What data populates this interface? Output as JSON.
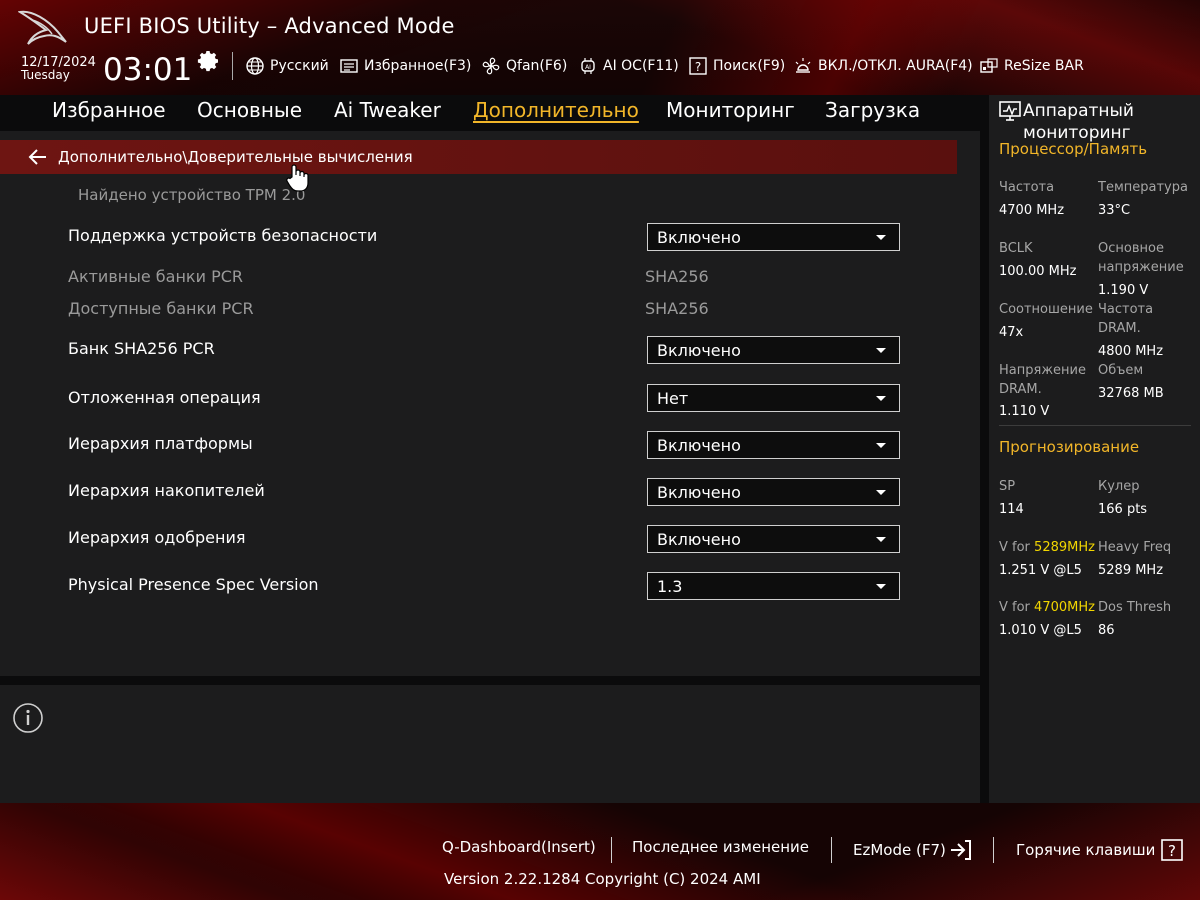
{
  "header": {
    "title": "UEFI BIOS Utility – Advanced Mode",
    "date": "12/17/2024",
    "weekday": "Tuesday",
    "time": "03:01",
    "tools": [
      {
        "label": "Русский",
        "icon": "globe-icon"
      },
      {
        "label": "Избранное(F3)",
        "icon": "favorites-icon"
      },
      {
        "label": "Qfan(F6)",
        "icon": "fan-icon"
      },
      {
        "label": "AI OC(F11)",
        "icon": "ai-chip-icon"
      },
      {
        "label": "Поиск(F9)",
        "icon": "help-search-icon"
      },
      {
        "label": "ВКЛ./ОТКЛ. AURA(F4)",
        "icon": "aura-light-icon"
      },
      {
        "label": "ReSize BAR",
        "icon": "resize-bar-icon"
      }
    ]
  },
  "tabs": [
    {
      "label": "Избранное",
      "active": false
    },
    {
      "label": "Основные",
      "active": false
    },
    {
      "label": "Ai Tweaker",
      "active": false
    },
    {
      "label": "Дополнительно",
      "active": true
    },
    {
      "label": "Мониторинг",
      "active": false
    },
    {
      "label": "Загрузка",
      "active": false
    }
  ],
  "main": {
    "breadcrumb": "Дополнительно\\Доверительные вычисления",
    "tpm_note": "Найдено устройство TPM 2.0",
    "rows": [
      {
        "label": "Поддержка устройств безопасности",
        "type": "dropdown",
        "value": "Включено"
      },
      {
        "label": "Активные банки PCR",
        "type": "static",
        "value": "SHA256"
      },
      {
        "label": "Доступные банки PCR",
        "type": "static",
        "value": "SHA256"
      },
      {
        "label": "Банк SHA256 PCR",
        "type": "dropdown",
        "value": "Включено"
      },
      {
        "label": "Отложенная операция",
        "type": "dropdown",
        "value": "Нет"
      },
      {
        "label": "Иерархия платформы",
        "type": "dropdown",
        "value": "Включено"
      },
      {
        "label": "Иерархия накопителей",
        "type": "dropdown",
        "value": "Включено"
      },
      {
        "label": "Иерархия одобрения",
        "type": "dropdown",
        "value": "Включено"
      },
      {
        "label": "Physical Presence Spec Version",
        "type": "dropdown",
        "value": "1.3"
      }
    ]
  },
  "hw_monitor": {
    "title": "Аппаратный мониторинг",
    "cpu_section": "Процессор/Память",
    "cpu": {
      "freq_label": "Частота",
      "freq_value": "4700 MHz",
      "temp_label": "Температура",
      "temp_value": "33°C",
      "bclk_label": "BCLK",
      "bclk_value": "100.00 MHz",
      "core_v_label": "Основное напряжение",
      "core_v_value": "1.190 V",
      "ratio_label": "Соотношение",
      "ratio_value": "47x",
      "dram_freq_label": "Частота DRAM.",
      "dram_freq_value": "4800 MHz",
      "dram_v_label": "Напряжение DRAM.",
      "dram_v_value": "1.110 V",
      "capacity_label": "Объем",
      "capacity_value": "32768 MB"
    },
    "prediction_section": "Прогнозирование",
    "prediction": {
      "sp_label": "SP",
      "sp_value": "114",
      "cooler_label": "Кулер",
      "cooler_value": "166 pts",
      "v_for_1_prefix": "V for",
      "v_for_1_freq": "5289MHz",
      "v_for_1_value": "1.251 V @L5",
      "heavy_label": "Heavy Freq",
      "heavy_value": "5289 MHz",
      "v_for_2_prefix": "V for",
      "v_for_2_freq": "4700MHz",
      "v_for_2_value": "1.010 V @L5",
      "dos_label": "Dos Thresh",
      "dos_value": "86"
    }
  },
  "footer": {
    "qdashboard": "Q-Dashboard(Insert)",
    "last_change": "Последнее изменение",
    "ezmode": "EzMode (F7)",
    "hotkeys": "Горячие клавиши",
    "version": "Version 2.22.1284 Copyright (C) 2024 AMI"
  },
  "colors": {
    "accent": "#f2b629",
    "highlight": "#f2d600",
    "breadcrumb_bar": "#6e1512",
    "panel": "#1c1c1d"
  }
}
